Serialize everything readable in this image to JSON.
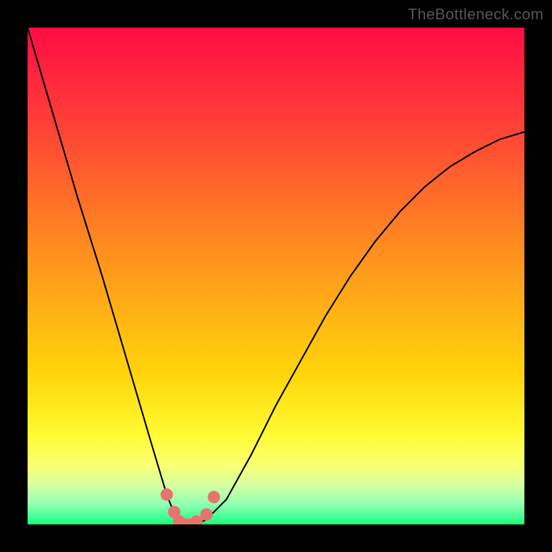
{
  "watermark": "TheBottleneck.com",
  "chart_data": {
    "type": "line",
    "title": "",
    "xlabel": "",
    "ylabel": "",
    "xlim": [
      0,
      100
    ],
    "ylim": [
      0,
      100
    ],
    "grid": false,
    "series": [
      {
        "name": "bottleneck-curve",
        "x": [
          0,
          5,
          10,
          15,
          20,
          25,
          28,
          30,
          31,
          32,
          33,
          34,
          36,
          40,
          45,
          50,
          55,
          60,
          65,
          70,
          75,
          80,
          85,
          90,
          95,
          100
        ],
        "y": [
          100,
          83,
          66,
          50,
          33,
          16,
          6,
          1,
          0,
          0,
          0,
          0,
          1,
          5,
          14,
          24,
          33,
          42,
          50,
          57,
          63,
          68,
          72,
          75,
          77.5,
          79
        ]
      }
    ],
    "markers": {
      "name": "highlight-dots",
      "color": "#e8736e",
      "points": [
        {
          "x": 28.0,
          "y": 6.0
        },
        {
          "x": 29.5,
          "y": 2.5
        },
        {
          "x": 30.5,
          "y": 0.6
        },
        {
          "x": 31.6,
          "y": 0.0
        },
        {
          "x": 32.8,
          "y": 0.0
        },
        {
          "x": 34.0,
          "y": 0.6
        },
        {
          "x": 36.0,
          "y": 2.0
        },
        {
          "x": 37.5,
          "y": 5.5
        }
      ]
    },
    "gradient_stops": [
      {
        "offset": 0.0,
        "color": "#ff0c44"
      },
      {
        "offset": 0.2,
        "color": "#ff4236"
      },
      {
        "offset": 0.45,
        "color": "#ff8f1e"
      },
      {
        "offset": 0.7,
        "color": "#ffd60a"
      },
      {
        "offset": 0.82,
        "color": "#fffb33"
      },
      {
        "offset": 0.88,
        "color": "#fbff73"
      },
      {
        "offset": 0.92,
        "color": "#d7ffa0"
      },
      {
        "offset": 0.96,
        "color": "#8fffb4"
      },
      {
        "offset": 1.0,
        "color": "#18ff7e"
      }
    ]
  }
}
